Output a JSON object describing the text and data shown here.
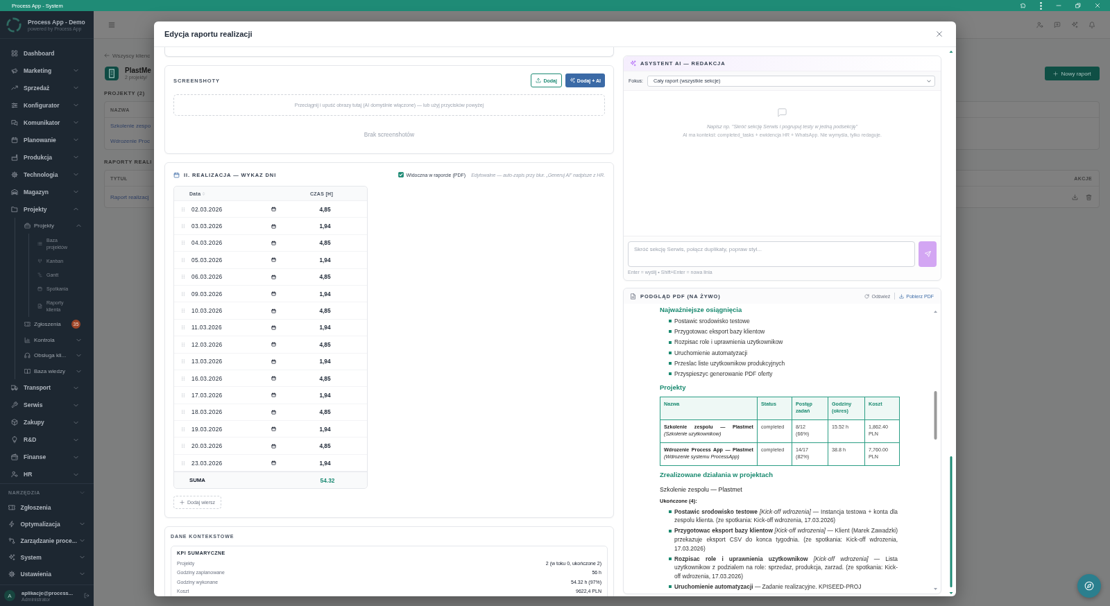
{
  "window": {
    "title": "Process App - System"
  },
  "sidebar": {
    "brand": "Process App - Demo",
    "brand_tagline": "powered by Process App",
    "items": [
      {
        "kind": "link",
        "label": "Dashboard"
      },
      {
        "kind": "group",
        "label": "Marketing",
        "expanded": false
      },
      {
        "kind": "group",
        "label": "Sprzedaż",
        "expanded": false
      },
      {
        "kind": "group",
        "label": "Konfigurator",
        "expanded": false
      },
      {
        "kind": "group",
        "label": "Komunikator",
        "expanded": false
      },
      {
        "kind": "group",
        "label": "Planowanie",
        "expanded": false
      },
      {
        "kind": "group",
        "label": "Produkcja",
        "expanded": false
      },
      {
        "kind": "group",
        "label": "Technologia",
        "expanded": false
      },
      {
        "kind": "group",
        "label": "Magazyn",
        "expanded": false
      },
      {
        "kind": "group",
        "label": "Projekty",
        "expanded": true,
        "children": [
          {
            "kind": "group",
            "label": "Projekty",
            "expanded": true,
            "children": [
              {
                "label": "Baza projektów"
              },
              {
                "label": "Kanban"
              },
              {
                "label": "Gantt"
              },
              {
                "label": "Spotkania"
              },
              {
                "label": "Raporty klienta"
              }
            ]
          },
          {
            "kind": "link",
            "label": "Zgłoszenia",
            "badge": "35"
          },
          {
            "kind": "group",
            "label": "Kontrola",
            "expanded": false
          },
          {
            "kind": "group",
            "label": "Obsługa kli...",
            "expanded": false
          },
          {
            "kind": "group",
            "label": "Baza wiedzy",
            "expanded": false
          }
        ]
      },
      {
        "kind": "group",
        "label": "Transport",
        "expanded": false
      },
      {
        "kind": "group",
        "label": "Serwis",
        "expanded": false
      },
      {
        "kind": "group",
        "label": "Zakupy",
        "expanded": false
      },
      {
        "kind": "group",
        "label": "R&D",
        "expanded": false
      },
      {
        "kind": "group",
        "label": "Finanse",
        "expanded": false
      },
      {
        "kind": "group",
        "label": "HR",
        "expanded": false
      }
    ],
    "tools": {
      "title": "NARZĘDZIA",
      "items": [
        {
          "kind": "link",
          "label": "Zgłoszenia"
        },
        {
          "kind": "group",
          "label": "Optymalizacja",
          "expanded": false
        },
        {
          "kind": "group",
          "label": "Zarządzanie proce...",
          "expanded": false
        },
        {
          "kind": "group",
          "label": "System",
          "expanded": false
        },
        {
          "kind": "group",
          "label": "Ustawienia",
          "expanded": false
        }
      ]
    },
    "user": {
      "initial": "A",
      "email": "aplikacje@process...",
      "role": "Administrator"
    }
  },
  "page": {
    "back_link": "Wszyscy klienc",
    "client_name": "PlastMe",
    "client_meta": "2 projekty/",
    "new_report_button": "Nowy raport",
    "projects": {
      "title": "PROJEKTY (2)",
      "columns": [
        "NAZWA"
      ],
      "rows": [
        "Szkolenie zespo",
        "Wdrozenie Proc"
      ]
    },
    "reports": {
      "title": "RAPORTY REALI",
      "columns": [
        "TYTUŁ",
        "AKCJE"
      ],
      "rows": [
        "Raport realizacj"
      ]
    }
  },
  "modal": {
    "title": "Edycja raportu realizacji",
    "screenshots": {
      "title": "SCREENSHOTY",
      "buttons": [
        {
          "kind": "upload",
          "label": "Dodaj"
        },
        {
          "kind": "ai",
          "label": "Dodaj + AI"
        }
      ],
      "dropzone": "Przeciągnij i upuść obrazy tutaj (AI domyślnie włączone) — lub użyj przycisków powyżej",
      "empty_text": "Brak screenshotów"
    },
    "days": {
      "title": "II. REALIZACJA — WYKAZ DNI",
      "pdf_toggle": {
        "label": "Widoczna w raporcie (PDF)",
        "checked": true
      },
      "hint": "Edytowalne — auto-zapis przy blur. „Generuj AI” nadpisze z HR.",
      "columns": [
        "Data",
        "CZAS [H]"
      ],
      "rows": [
        {
          "date": "02.03.2026",
          "hours": "4,85"
        },
        {
          "date": "03.03.2026",
          "hours": "1,94"
        },
        {
          "date": "04.03.2026",
          "hours": "4,85"
        },
        {
          "date": "05.03.2026",
          "hours": "1,94"
        },
        {
          "date": "06.03.2026",
          "hours": "4,85"
        },
        {
          "date": "09.03.2026",
          "hours": "1,94"
        },
        {
          "date": "10.03.2026",
          "hours": "4,85"
        },
        {
          "date": "11.03.2026",
          "hours": "1,94"
        },
        {
          "date": "12.03.2026",
          "hours": "4,85"
        },
        {
          "date": "13.03.2026",
          "hours": "1,94"
        },
        {
          "date": "16.03.2026",
          "hours": "4,85"
        },
        {
          "date": "17.03.2026",
          "hours": "1,94"
        },
        {
          "date": "18.03.2026",
          "hours": "4,85"
        },
        {
          "date": "19.03.2026",
          "hours": "1,94"
        },
        {
          "date": "20.03.2026",
          "hours": "4,85"
        },
        {
          "date": "23.03.2026",
          "hours": "1,94"
        }
      ],
      "total_label": "SUMA",
      "total": "54.32",
      "add_button": "Dodaj wiersz"
    },
    "context": {
      "title": "DANE KONTEKSTOWE",
      "kpi": {
        "title": "KPI SUMARYCZNE",
        "rows": [
          {
            "label": "Projekty",
            "value": "2 (w toku 0, ukończone 2)"
          },
          {
            "label": "Godziny zaplanowane",
            "value": "56 h"
          },
          {
            "label": "Godziny wykonane",
            "value": "54.32 h (97%)"
          },
          {
            "label": "Koszt",
            "value": "9622,4 PLN"
          }
        ]
      }
    },
    "assistant": {
      "title": "ASYSTENT AI — REDAKCJA",
      "focus_label": "Fokus:",
      "focus_value": "Cały raport (wszystkie sekcje)",
      "empty_prompt": "Napisz np. \"Skróć sekcję Serwis i pogrupuj testy w jedną podsekcję\"",
      "empty_note": "AI ma kontekst: completed_tasks + ewidencja HR + WhatsApp. Nie wymyśla, tylko redaguje.",
      "input": {
        "placeholder": "Skróć sekcję Serwis, połącz duplikaty, popraw styl..."
      },
      "send_button": {
        "disabled": true
      },
      "input_hint": "Enter = wyślij • Shift+Enter = nowa linia"
    },
    "pdf_preview": {
      "title": "PODGLĄD PDF (NA ŻYWO)",
      "actions": [
        {
          "kind": "refresh",
          "label": "Odśwież"
        },
        {
          "kind": "download",
          "label": "Pobierz PDF"
        }
      ],
      "blocks": [
        {
          "kind": "heading",
          "text": "Najważniejsze osiągnięcia"
        },
        {
          "kind": "list",
          "items": [
            "Postawic srodowisko testowe",
            "Przygotowac eksport bazy klientow",
            "Rozpisac role i uprawnienia uzytkownikow",
            "Uruchomienie automatyzacji",
            "Przeslac liste uzytkownikow produkcyjnych",
            "Przyspieszyc generowanie PDF oferty"
          ]
        },
        {
          "kind": "heading",
          "text": "Projekty"
        },
        {
          "kind": "table",
          "columns": [
            "Nazwa",
            "Status",
            "Postęp zadań",
            "Godziny (okres)",
            "Koszt"
          ],
          "rows": [
            [
              "**Szkolenie zespolu — Plastmet** *(Szkolenie uzytkownikow)*",
              "completed",
              "8/12 (66%)",
              "15.52 h",
              "1,862.40 PLN"
            ],
            [
              "**Wdrozenie Process App — Plastmet** *(Wdrozenie systemu ProcessApp)*",
              "completed",
              "14/17 (82%)",
              "38.8 h",
              "7,760.00 PLN"
            ]
          ]
        },
        {
          "kind": "heading",
          "text": "Zrealizowane działania w projektach"
        },
        {
          "kind": "subheading",
          "text": "Szkolenie zespolu — Plastmet"
        },
        {
          "kind": "label",
          "text": "Ukończone (4):"
        },
        {
          "kind": "list",
          "items": [
            "**Postawic srodowisko testowe** *[Kick-off wdrozenia]* — Instancja testowa + konta dla zespolu klienta. (ze spotkania: Kick-off wdrozenia, 17.03.2026)",
            "**Przygotowac eksport bazy klientow** *[Kick-off wdrozenia]* — Klient (Marek Zawadzki) przekazuje eksport CSV do konca tygodnia. (ze spotkania: Kick-off wdrozenia, 17.03.2026)",
            "**Rozpisac role i uprawnienia uzytkownikow** *[Kick-off wdrozenia]* — Lista uzytkownikow z podzialem na role: sprzedaz, produkcja, zarzad. (ze spotkania: Kick-off wdrozenia, 17.03.2026)",
            "**Uruchomienie automatyzacji** — Zadanie realizacyjne. KPISEED-PROJ"
          ]
        }
      ]
    }
  }
}
